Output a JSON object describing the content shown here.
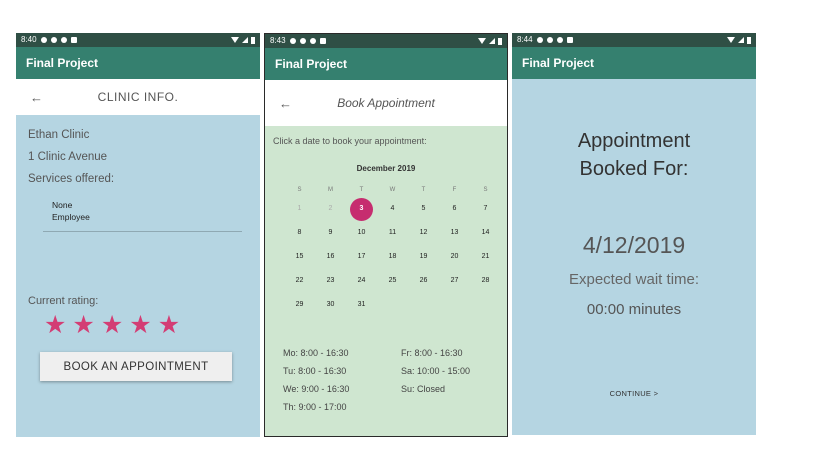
{
  "app_title": "Final Project",
  "screen1": {
    "time": "8:40",
    "header": "CLINIC INFO.",
    "clinic_name": "Ethan Clinic",
    "address": "1 Clinic Avenue",
    "services_label": "Services offered:",
    "services": [
      "None",
      "Employee"
    ],
    "rating_label": "Current rating:",
    "rating": 5,
    "book_button": "BOOK AN APPOINTMENT"
  },
  "screen2": {
    "time": "8:43",
    "header": "Book Appointment",
    "instruction": "Click a date to book your appointment:",
    "month": "December 2019",
    "weekdays": [
      "S",
      "M",
      "T",
      "W",
      "T",
      "F",
      "S"
    ],
    "days": [
      "1",
      "2",
      "3",
      "4",
      "5",
      "6",
      "7",
      "8",
      "9",
      "10",
      "11",
      "12",
      "13",
      "14",
      "15",
      "16",
      "17",
      "18",
      "19",
      "20",
      "21",
      "22",
      "23",
      "24",
      "25",
      "26",
      "27",
      "28",
      "29",
      "30",
      "31"
    ],
    "selected_day": "3",
    "disabled_days": [
      "1",
      "2"
    ],
    "hours": {
      "mo": "Mo: 8:00 - 16:30",
      "tu": "Tu: 8:00 - 16:30",
      "we": "We: 9:00 - 16:30",
      "th": "Th: 9:00 - 17:00",
      "fr": "Fr: 8:00 - 16:30",
      "sa": "Sa: 10:00 - 15:00",
      "su": "Su: Closed"
    }
  },
  "screen3": {
    "time": "8:44",
    "title_line1": "Appointment",
    "title_line2": "Booked For:",
    "date": "4/12/2019",
    "wait_label": "Expected wait time:",
    "wait_value": "00:00 minutes",
    "continue_label": "CONTINUE >"
  },
  "colors": {
    "status_bar": "#2f4f45",
    "app_bar": "#35806f",
    "blue_panel": "#b5d5e2",
    "green_panel": "#cfe6d0",
    "accent": "#c62d6f",
    "star": "#d33d74"
  }
}
